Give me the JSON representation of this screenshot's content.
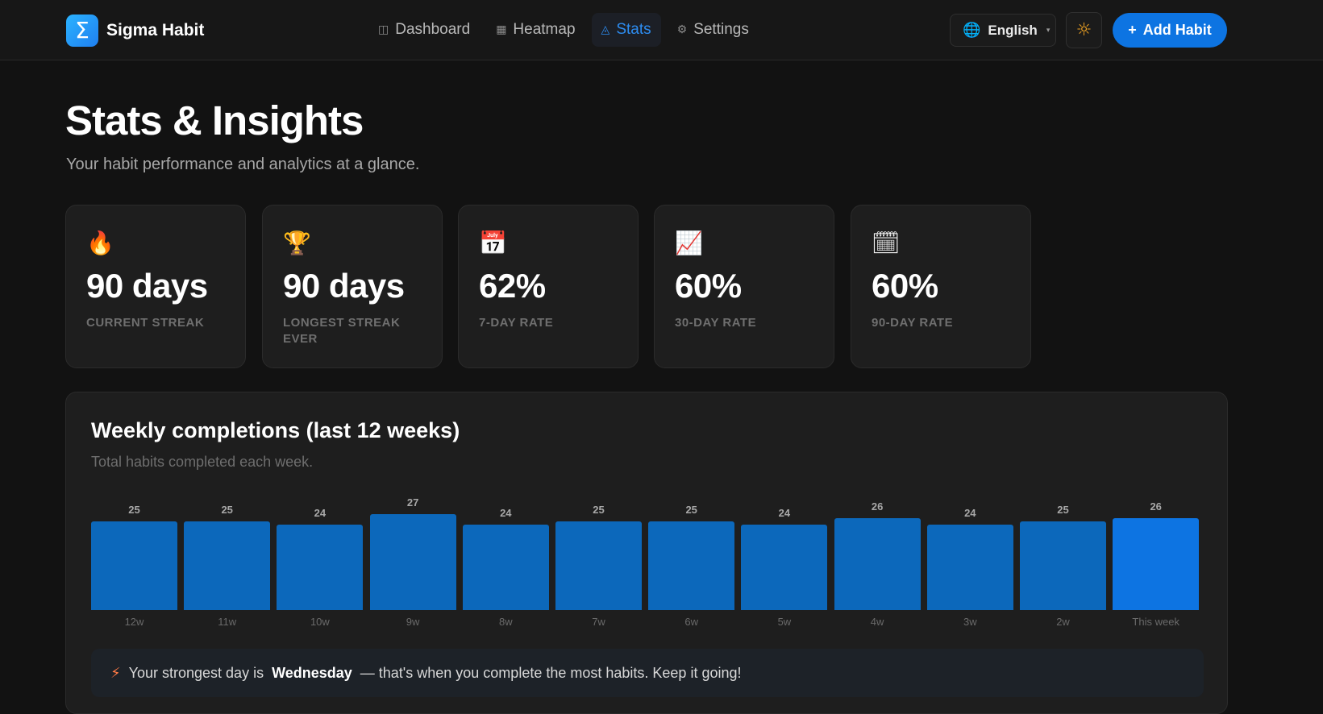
{
  "app": {
    "logo_symbol": "Σ",
    "name": "Sigma Habit"
  },
  "nav": {
    "items": [
      {
        "icon": "dashboard-icon",
        "glyph": "◫",
        "label": "Dashboard"
      },
      {
        "icon": "heatmap-icon",
        "glyph": "▦",
        "label": "Heatmap"
      },
      {
        "icon": "stats-icon",
        "glyph": "◬",
        "label": "Stats"
      },
      {
        "icon": "gear-icon",
        "glyph": "⚙",
        "label": "Settings"
      }
    ],
    "active": "Stats"
  },
  "language": {
    "label": "English",
    "globe": "🌐",
    "caret": "▾"
  },
  "theme_toggle": {
    "glyph": "☼"
  },
  "add_habit": {
    "plus": "+",
    "label": "Add Habit"
  },
  "page": {
    "title": "Stats & Insights",
    "subtitle": "Your habit performance and analytics at a glance."
  },
  "stats": [
    {
      "icon": "fire-icon",
      "glyph": "🔥",
      "value": "90 days",
      "label": "CURRENT STREAK"
    },
    {
      "icon": "trophy-icon",
      "glyph": "🏆",
      "value": "90 days",
      "label": "LONGEST STREAK EVER"
    },
    {
      "icon": "calendar-icon",
      "glyph": "📅",
      "value": "62%",
      "label": "7-DAY RATE"
    },
    {
      "icon": "chart-up-icon",
      "glyph": "📈",
      "value": "60%",
      "label": "30-DAY RATE"
    },
    {
      "icon": "spiral-calendar-icon",
      "glyph": "🗓",
      "value": "60%",
      "label": "90-DAY RATE"
    }
  ],
  "weekly": {
    "title": "Weekly completions (last 12 weeks)",
    "subtitle": "Total habits completed each week."
  },
  "chart_data": {
    "type": "bar",
    "categories": [
      "12w",
      "11w",
      "10w",
      "9w",
      "8w",
      "7w",
      "6w",
      "5w",
      "4w",
      "3w",
      "2w",
      "This week"
    ],
    "values": [
      25,
      25,
      24,
      27,
      24,
      25,
      25,
      24,
      26,
      24,
      25,
      26
    ],
    "highlight_last": true,
    "colors": {
      "bar": "#0c68bb",
      "current": "#0d74e2"
    },
    "grid": false
  },
  "insight": {
    "glyph": "⚡",
    "prefix": "Your strongest day is",
    "day": "Wednesday",
    "suffix": "— that's when you complete the most habits. Keep it going!"
  }
}
